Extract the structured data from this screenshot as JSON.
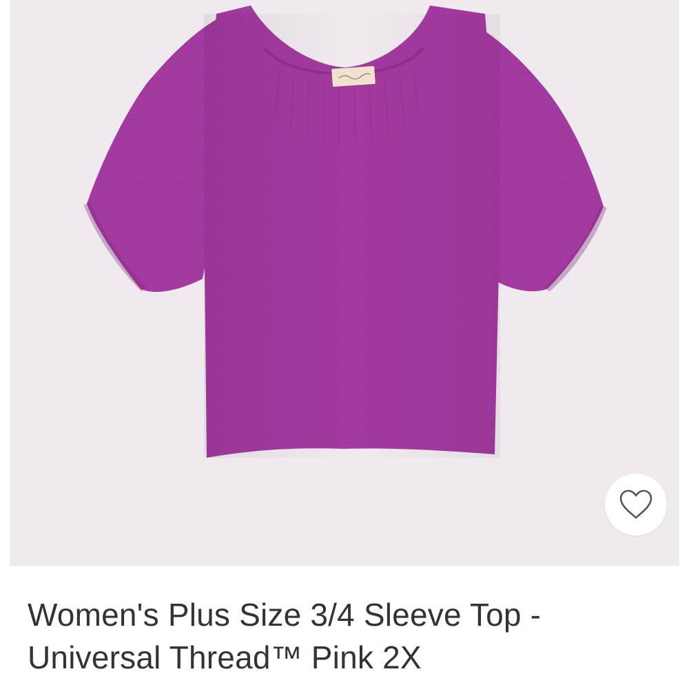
{
  "product": {
    "title": "Women's Plus Size 3/4 Sleeve Top - Universal Thread™ Pink 2X",
    "image_alt": "Pink 3/4 sleeve gauze top",
    "garment_color": "#a33a9f",
    "image_background": "#eeeaee"
  },
  "favorite": {
    "icon": "heart-outline-icon"
  }
}
